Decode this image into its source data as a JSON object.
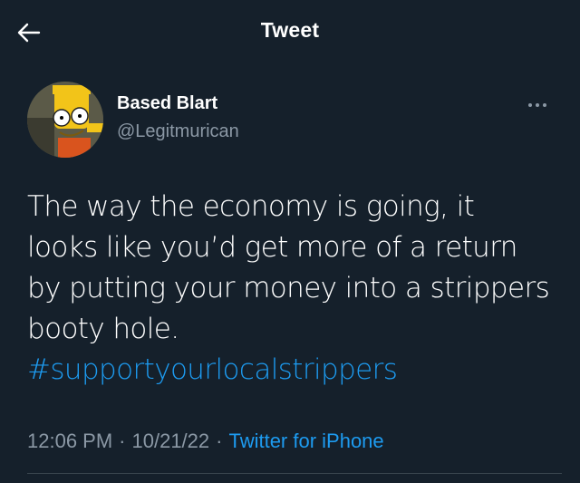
{
  "header": {
    "title": "Tweet",
    "back_icon": "arrow-left-icon"
  },
  "author": {
    "display_name": "Based Blart",
    "handle": "@Legitmurican",
    "avatar_icon": "cartoon-avatar"
  },
  "tweet": {
    "lines": [
      "The way the economy is going, it",
      "looks like you’d get more of a return",
      "by putting your money into a strippers",
      "booty hole."
    ],
    "hashtag": "#supportyourlocalstrippers"
  },
  "meta": {
    "time": "12:06 PM",
    "separator": "·",
    "date": "10/21/22",
    "source": "Twitter for iPhone"
  },
  "colors": {
    "background": "#15202b",
    "link": "#1d9bf0",
    "secondary_text": "#8b98a5"
  }
}
